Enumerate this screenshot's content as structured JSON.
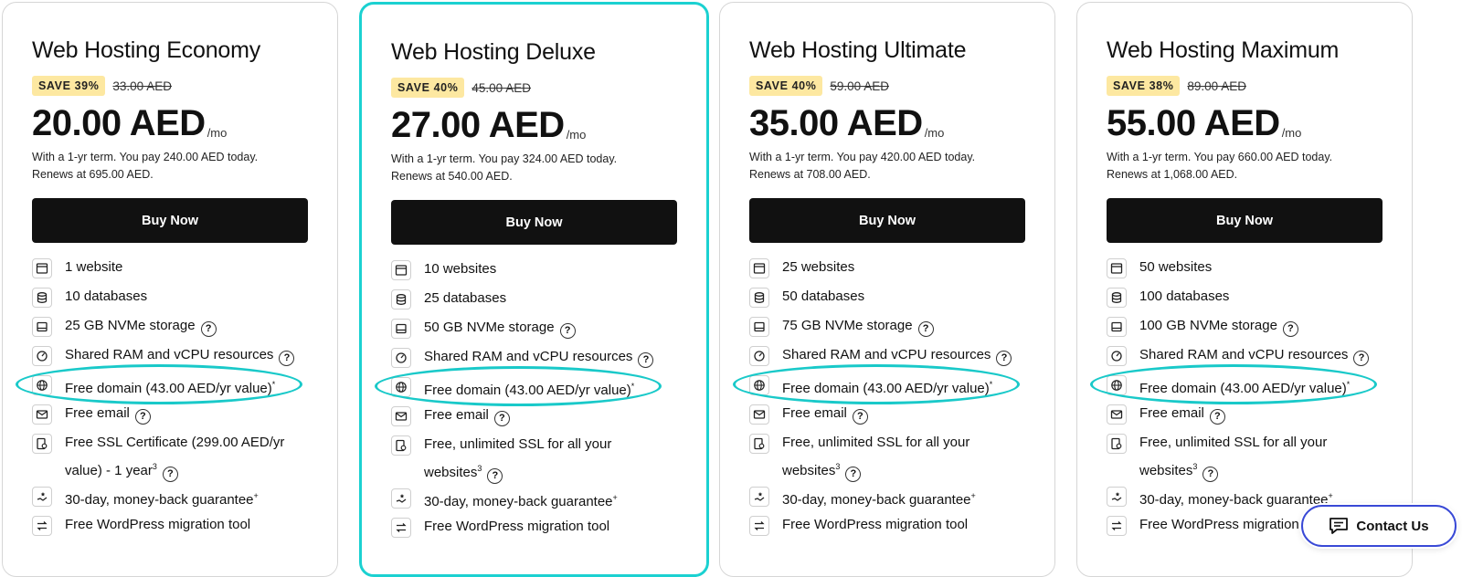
{
  "plans": [
    {
      "title": "Web Hosting Economy",
      "save": "SAVE 39%",
      "old_price": "33.00 AED",
      "price": "20.00 AED",
      "per": "/mo",
      "term1": "With a 1-yr term. You pay 240.00 AED today.",
      "term2": "Renews at 695.00 AED.",
      "buy": "Buy Now",
      "features": {
        "websites": "1 website",
        "databases": "10 databases",
        "storage": "25 GB NVMe storage",
        "ram": "Shared RAM and vCPU resources",
        "domain": "Free domain (43.00 AED/yr value)",
        "email": "Free email",
        "ssl": "Free SSL Certificate (299.00 AED/yr value) - 1 year",
        "ssl_sup": "3",
        "guarantee": "30-day, money-back guarantee",
        "migration": "Free WordPress migration tool"
      }
    },
    {
      "title": "Web Hosting Deluxe",
      "save": "SAVE 40%",
      "old_price": "45.00 AED",
      "price": "27.00 AED",
      "per": "/mo",
      "term1": "With a 1-yr term. You pay 324.00 AED today.",
      "term2": "Renews at 540.00 AED.",
      "buy": "Buy Now",
      "features": {
        "websites": "10 websites",
        "databases": "25 databases",
        "storage": "50 GB NVMe storage",
        "ram": "Shared RAM and vCPU resources",
        "domain": "Free domain (43.00 AED/yr value)",
        "email": "Free email",
        "ssl": "Free, unlimited SSL for all your websites",
        "ssl_sup": "3",
        "guarantee": "30-day, money-back guarantee",
        "migration": "Free WordPress migration tool"
      }
    },
    {
      "title": "Web Hosting Ultimate",
      "save": "SAVE 40%",
      "old_price": "59.00 AED",
      "price": "35.00 AED",
      "per": "/mo",
      "term1": "With a 1-yr term. You pay 420.00 AED today.",
      "term2": "Renews at 708.00 AED.",
      "buy": "Buy Now",
      "features": {
        "websites": "25 websites",
        "databases": "50 databases",
        "storage": "75 GB NVMe storage",
        "ram": "Shared RAM and vCPU resources",
        "domain": "Free domain (43.00 AED/yr value)",
        "email": "Free email",
        "ssl": "Free, unlimited SSL for all your websites",
        "ssl_sup": "3",
        "guarantee": "30-day, money-back guarantee",
        "migration": "Free WordPress migration tool"
      }
    },
    {
      "title": "Web Hosting Maximum",
      "save": "SAVE 38%",
      "old_price": "89.00 AED",
      "price": "55.00 AED",
      "per": "/mo",
      "term1": "With a 1-yr term. You pay 660.00 AED today.",
      "term2": "Renews at 1,068.00 AED.",
      "buy": "Buy Now",
      "features": {
        "websites": "50 websites",
        "databases": "100 databases",
        "storage": "100 GB NVMe storage",
        "ram": "Shared RAM and vCPU resources",
        "domain": "Free domain (43.00 AED/yr value)",
        "email": "Free email",
        "ssl": "Free, unlimited SSL for all your websites",
        "ssl_sup": "3",
        "guarantee": "30-day, money-back guarantee",
        "migration": "Free WordPress migration tool"
      }
    }
  ],
  "featured_plan": "Web Hosting Deluxe",
  "marks": {
    "help": "?",
    "domain_sup": "*",
    "guarantee_sup": "+"
  },
  "contact": {
    "label": "Contact Us"
  },
  "colors": {
    "accent": "#1bd1d1",
    "badge": "#fde8a1",
    "button": "#111111",
    "contact_border": "#3949d6"
  }
}
